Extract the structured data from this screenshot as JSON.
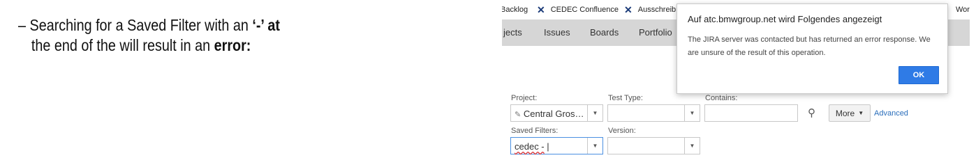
{
  "slide": {
    "bullet": "–",
    "line1_prefix": "Searching for a Saved Filter with an ",
    "line1_bold": "‘-’ at",
    "line2_prefix": "the end of the will result in an ",
    "line2_bold": "error:"
  },
  "bookmarks": {
    "items": [
      {
        "label": "Backlog",
        "icon": "confluence-x-icon"
      },
      {
        "label": "CEDEC Confluence",
        "icon": "confluence-x-icon"
      },
      {
        "label": "Ausschreib",
        "icon": "confluence-x-icon"
      }
    ],
    "trailing": "Work"
  },
  "nav": {
    "items": [
      "jects",
      "Issues",
      "Boards",
      "Portfolio"
    ]
  },
  "filters": {
    "project_label": "Project:",
    "project_value": "Central Gros…",
    "test_type_label": "Test Type:",
    "test_type_value": "",
    "contains_label": "Contains:",
    "contains_value": "",
    "more_label": "More",
    "advanced_label": "Advanced",
    "saved_filters_label": "Saved Filters:",
    "saved_filters_value": "cedec -",
    "saved_filters_caret": "|",
    "version_label": "Version:",
    "version_value": ""
  },
  "dialog": {
    "title": "Auf atc.bmwgroup.net wird Folgendes angezeigt",
    "message": "The JIRA server was contacted but has returned an error response. We are unsure of the result of this operation.",
    "ok_label": "OK"
  },
  "colors": {
    "nav_background": "#d6d6d6",
    "ok_button": "#2f7be6",
    "link": "#2a6ebb"
  }
}
